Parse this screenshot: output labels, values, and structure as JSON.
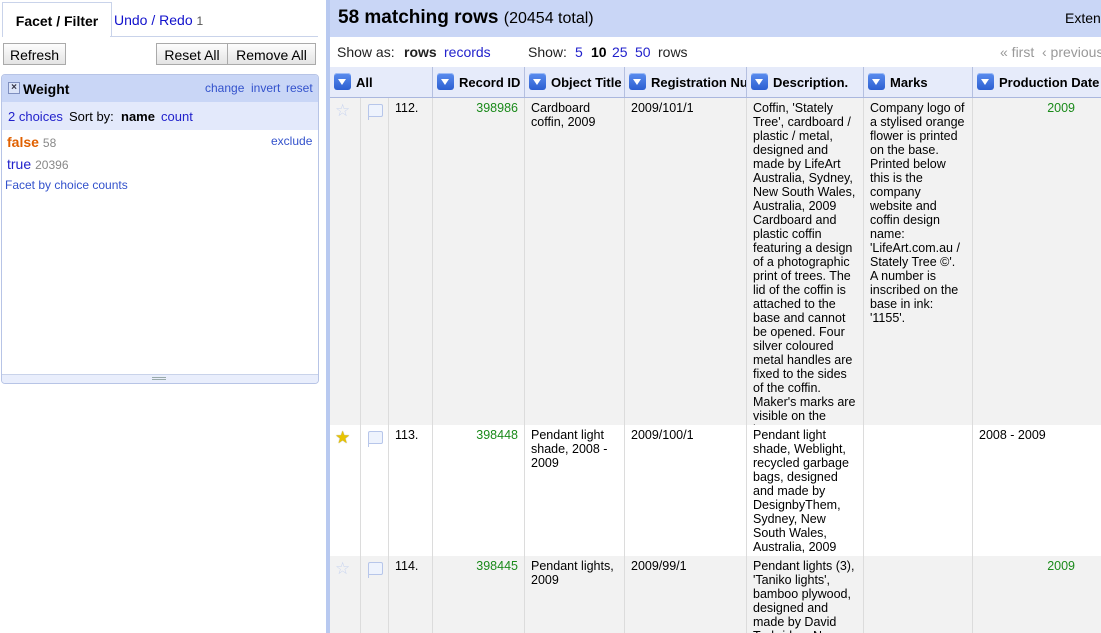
{
  "left": {
    "tabs": {
      "facet": "Facet / Filter",
      "undo": "Undo / Redo",
      "undo_count": "1"
    },
    "buttons": {
      "refresh": "Refresh",
      "reset_all": "Reset All",
      "remove_all": "Remove All"
    },
    "facet": {
      "close": "×",
      "title": "Weight",
      "actions": {
        "change": "change",
        "invert": "invert",
        "reset": "reset"
      },
      "choices_label": "2 choices",
      "sort_by": "Sort by:",
      "sort_name": "name",
      "sort_count": "count",
      "choices": [
        {
          "label": "false",
          "count": "58",
          "selected": true
        },
        {
          "label": "true",
          "count": "20396",
          "selected": false
        }
      ],
      "exclude": "exclude",
      "by_choice_counts": "Facet by choice counts"
    }
  },
  "header": {
    "title": "58 matching rows",
    "total": "(20454 total)",
    "extensions": "Extensions:"
  },
  "viewbar": {
    "show_as": "Show as:",
    "rows": "rows",
    "records": "records",
    "show": "Show:",
    "page_sizes": [
      "5",
      "10",
      "25",
      "50"
    ],
    "current_page_size": "10",
    "rows_label": "rows",
    "first": "« first",
    "previous": "‹ previous"
  },
  "columns": [
    "All",
    "Record ID",
    "Object Title",
    "Registration Number",
    "Description.",
    "Marks",
    "Production Date"
  ],
  "rows": [
    {
      "starred": false,
      "index": "112.",
      "record_id": "398986",
      "title": "Cardboard coffin, 2009",
      "reg": "2009/101/1",
      "description": "Coffin, 'Stately Tree', cardboard / plastic / metal, designed and made by LifeArt Australia, Sydney, New South Wales, Australia, 2009 Cardboard and plastic coffin featuring a design of a photographic print of trees. The lid of the coffin is attached to the base and cannot be opened. Four silver coloured metal handles are fixed to the sides of the coffin. Maker's marks are visible on the base.",
      "marks": "Company logo of a stylised orange flower is printed on the base. Printed below this is the company website and coffin design name: 'LifeArt.com.au / Stately Tree ©'. A number is inscribed on the base in ink: '1155'.",
      "date": "2009",
      "date_numeric": true
    },
    {
      "starred": true,
      "index": "113.",
      "record_id": "398448",
      "title": "Pendant light shade, 2008 - 2009",
      "reg": "2009/100/1",
      "description": "Pendant light shade, Weblight, recycled garbage bags, designed and made by DesignbyThem, Sydney, New South Wales, Australia, 2009",
      "marks": "",
      "date": "2008 - 2009",
      "date_numeric": false
    },
    {
      "starred": false,
      "index": "114.",
      "record_id": "398445",
      "title": "Pendant lights, 2009",
      "reg": "2009/99/1",
      "description": "Pendant lights (3), 'Taniko lights', bamboo plywood, designed and made by David Trubridge, New",
      "marks": "",
      "date": "2009",
      "date_numeric": true
    }
  ],
  "colors": {
    "header_bg": "#c9d6f6",
    "selected_choice": "#e06000",
    "link": "#2222cc",
    "numeric": "#1a8a1a"
  }
}
